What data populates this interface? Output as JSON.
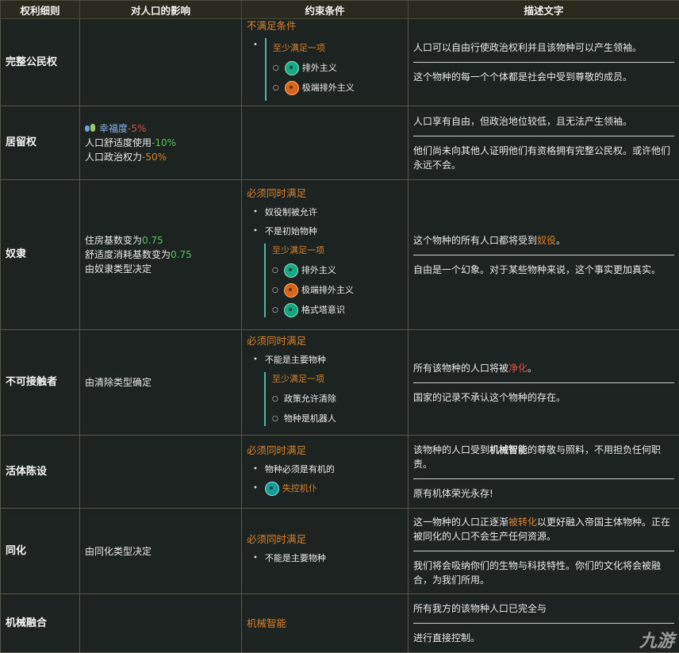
{
  "headers": [
    "权利细则",
    "对人口的影响",
    "约束条件",
    "描述文字"
  ],
  "rows": [
    {
      "name": "完整公民权",
      "effects": [],
      "cond_head": "不满足条件",
      "cond_top": "至少满足一项",
      "cond_items": [
        "排外主义",
        "极端排外主义"
      ],
      "desc": [
        "人口可以自由行使政治权利并且该物种可以产生领袖。",
        "这个物种的每一个个体都是社会中受到尊敬的成员。"
      ]
    },
    {
      "name": "居留权",
      "effects": {
        "happiness_label": "幸福度",
        "happiness_value": "-5%",
        "amenity_label": "人口舒适度使用",
        "amenity_value": "-10%",
        "power_label": "人口政治权力",
        "power_value": "-50%"
      },
      "desc": [
        "人口享有自由，但政治地位较低，且无法产生领袖。",
        "他们尚未向其他人证明他们有资格拥有完整公民权。或许他们永远不会。"
      ]
    },
    {
      "name": "奴隶",
      "effects": {
        "housing_label": "住房基数变为",
        "housing_value": "0.75",
        "amenity_label": "舒适度消耗基数变为",
        "amenity_value": "0.75",
        "type_label": "由奴隶类型决定"
      },
      "cond_head": "必须同时满足",
      "cond_b1": "奴役制被允许",
      "cond_b2": "不是初始物种",
      "cond_group_head": "至少满足一项",
      "cond_items": [
        "排外主义",
        "极端排外主义",
        "格式塔意识"
      ],
      "desc_a": "这个物种的所有人口都将受到",
      "desc_hl": "奴役",
      "desc_b": "。",
      "desc2": "自由是一个幻象。对于某些物种来说，这个事实更加真实。"
    },
    {
      "name": "不可接触者",
      "effect": "由清除类型确定",
      "cond_head": "必须同时满足",
      "cond_b1": "不能是主要物种",
      "cond_group_head": "至少满足一项",
      "cond_items": [
        "政策允许清除",
        "物种是机器人"
      ],
      "desc_a": "所有该物种的人口将被",
      "desc_hl": "净化",
      "desc_b": "。",
      "desc2": "国家的记录不承认这个物种的存在。"
    },
    {
      "name": "活体陈设",
      "cond_head": "必须同时满足",
      "cond_b1": "物种必须是有机的",
      "cond_b2": "失控机仆",
      "desc_a": "该物种的人口受到",
      "desc_bold": "机械智能",
      "desc_b": "的尊敬与照料，不用担负任何职责。",
      "desc2": "原有机体荣光永存!"
    },
    {
      "name": "同化",
      "effect": "由同化类型决定",
      "cond_head": "必须同时满足",
      "cond_b1": "不能是主要物种",
      "desc_a": "这一物种的人口正逐渐",
      "desc_hl": "被转化",
      "desc_b": "以更好融入帝国主体物种。正在被同化的人口不会生产任何资源。",
      "desc2": "我们将会吸纳你们的生物与科技特性。你们的文化将会被融合，为我们所用。"
    },
    {
      "name": "机械融合",
      "cond_head": "机械智能",
      "desc1": "所有我方的该物种人口已完全与",
      "desc2": "进行直接控制。"
    }
  ],
  "watermark": "九游"
}
